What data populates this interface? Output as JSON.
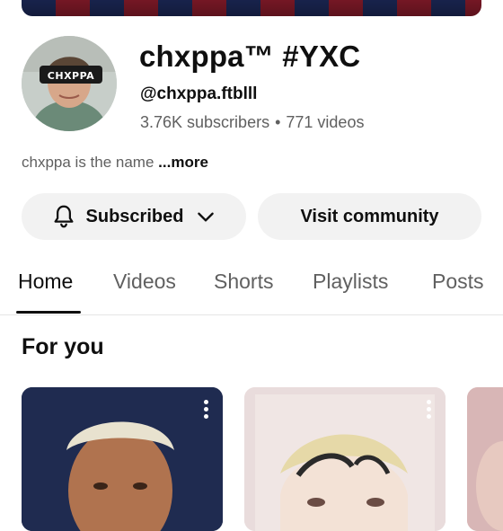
{
  "channel": {
    "name": "chxppa™ #YXC",
    "handle": "@chxppa.ftblll",
    "subscribers": "3.76K subscribers",
    "separator": "•",
    "videos": "771 videos",
    "description": "chxppa is the name",
    "more_label": "...more",
    "avatar_overlay_text": "CHXPPA"
  },
  "buttons": {
    "subscribed_label": "Subscribed",
    "community_label": "Visit community"
  },
  "tabs": [
    {
      "label": "Home",
      "active": true
    },
    {
      "label": "Videos",
      "active": false
    },
    {
      "label": "Shorts",
      "active": false
    },
    {
      "label": "Playlists",
      "active": false
    },
    {
      "label": "Posts",
      "active": false
    }
  ],
  "section": {
    "title": "For you"
  },
  "icons": {
    "subscribed": "bell-icon",
    "dropdown": "chevron-down-icon",
    "menu": "more-vertical-icon"
  },
  "colors": {
    "text_primary": "#0f0f0f",
    "text_secondary": "#606060",
    "button_bg": "#f2f2f2"
  }
}
